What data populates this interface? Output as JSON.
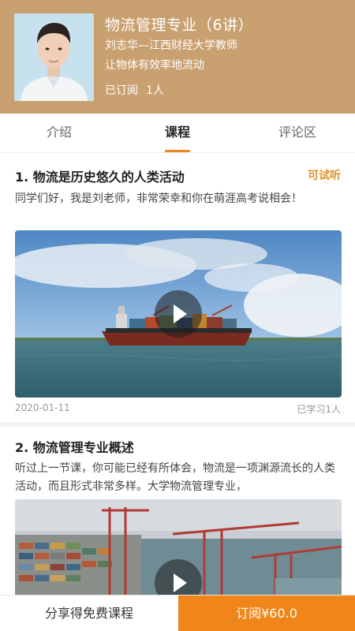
{
  "header": {
    "title": "物流管理专业（6讲）",
    "teacher": "刘志华—江西财经大学教师",
    "slogan": "让物体有效率地流动",
    "subscribed_label": "已订阅",
    "subscribed_count": "1人"
  },
  "tabs": [
    {
      "label": "介绍",
      "active": false
    },
    {
      "label": "课程",
      "active": true
    },
    {
      "label": "评论区",
      "active": false
    }
  ],
  "lessons": [
    {
      "title": "1. 物流是历史悠久的人类活动",
      "badge": "可试听",
      "desc": "同学们好，我是刘老师，非常荣幸和你在萌涯高考说相会！",
      "date": "2020-01-11",
      "learned": "已学习1人",
      "thumbnail": "cargo-ship-video"
    },
    {
      "title": "2. 物流管理专业概述",
      "desc": "听过上一节课，你可能已经有所体会，物流是一项渊源流长的人类活动，而且形式非常多样。大学物流管理专业，",
      "thumbnail": "container-port-video"
    }
  ],
  "bottom_bar": {
    "share_label": "分享得免费课程",
    "subscribe_label": "订阅¥60.0"
  },
  "colors": {
    "header_bg": "#c9a070",
    "accent": "#f08519",
    "trial_badge": "#e0932c"
  }
}
